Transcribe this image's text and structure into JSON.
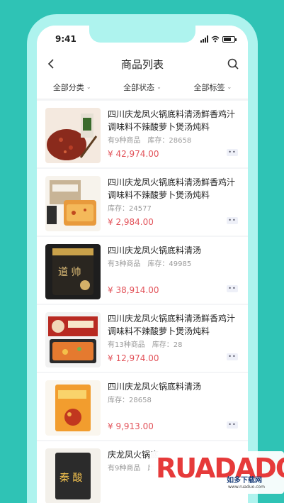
{
  "status": {
    "time": "9:41"
  },
  "header": {
    "title": "商品列表"
  },
  "filters": [
    "全部分类",
    "全部状态",
    "全部标签"
  ],
  "products": [
    {
      "name": "四川庆龙凤火锅底料清汤鲜香鸡汁调味料不辣酸萝卜煲汤炖料",
      "meta": [
        "有9种商品",
        "库存：28658"
      ],
      "price": "¥ 42,974.00"
    },
    {
      "name": "四川庆龙凤火锅底料清汤鲜香鸡汁调味料不辣酸萝卜煲汤炖料",
      "meta": [
        "库存：24577"
      ],
      "price": "¥ 2,984.00"
    },
    {
      "name": "四川庆龙凤火锅底料清汤",
      "meta": [
        "有3种商品",
        "库存：49985"
      ],
      "price": "¥ 38,914.00"
    },
    {
      "name": "四川庆龙凤火锅底料清汤鲜香鸡汁调味料不辣酸萝卜煲汤炖料",
      "meta": [
        "有13种商品",
        "库存：28"
      ],
      "price": "¥ 12,974.00"
    },
    {
      "name": "四川庆龙凤火锅底料清汤",
      "meta": [
        "库存：28658"
      ],
      "price": "¥ 9,913.00"
    },
    {
      "name": "庆龙凤火锅底",
      "meta": [
        "有9种商品",
        "库"
      ],
      "price": ""
    }
  ],
  "watermark": {
    "logo": "RUADADO",
    "name": "如多下载网",
    "url": "www.ruaduo.com"
  },
  "colors": {
    "accent": "#e2535a",
    "background": "#2fc3b5"
  }
}
